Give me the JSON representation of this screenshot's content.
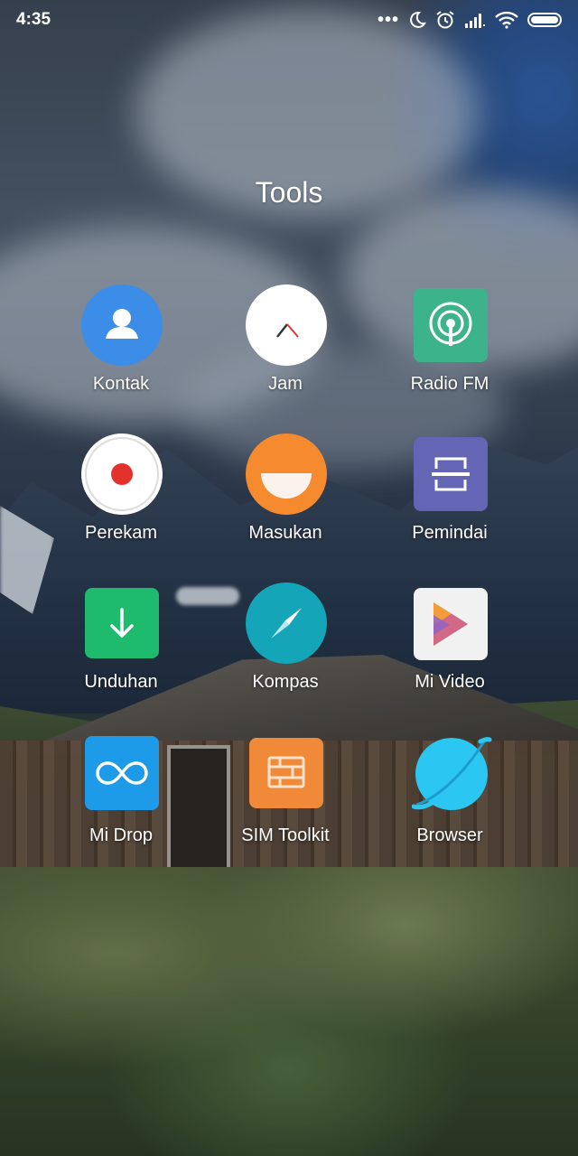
{
  "status_bar": {
    "time": "4:35",
    "icons": [
      "more-dots-icon",
      "do-not-disturb-moon-icon",
      "alarm-clock-icon",
      "cellular-signal-icon",
      "wifi-icon",
      "battery-icon"
    ]
  },
  "folder": {
    "title": "Tools",
    "apps": [
      {
        "label": "Kontak",
        "icon": "contact-person-icon",
        "color": "#3b8de8"
      },
      {
        "label": "Jam",
        "icon": "clock-icon",
        "color": "#ffffff"
      },
      {
        "label": "Radio FM",
        "icon": "radio-broadcast-icon",
        "color": "#3db38c"
      },
      {
        "label": "Perekam",
        "icon": "record-dot-icon",
        "color": "#ffffff"
      },
      {
        "label": "Masukan",
        "icon": "feedback-smile-icon",
        "color": "#f58a2e"
      },
      {
        "label": "Pemindai",
        "icon": "scanner-frame-icon",
        "color": "#6565b5"
      },
      {
        "label": "Unduhan",
        "icon": "download-arrow-icon",
        "color": "#1ebb6e"
      },
      {
        "label": "Kompas",
        "icon": "compass-needle-icon",
        "color": "#14a6b8"
      },
      {
        "label": "Mi Video",
        "icon": "play-triangle-icon",
        "color": "#f1f1f1"
      },
      {
        "label": "Mi Drop",
        "icon": "infinity-icon",
        "color": "#1e9be8"
      },
      {
        "label": "SIM Toolkit",
        "icon": "sim-card-icon",
        "color": "#f18a38"
      },
      {
        "label": "Browser",
        "icon": "planet-icon",
        "color": "#2bc6f1"
      }
    ]
  }
}
